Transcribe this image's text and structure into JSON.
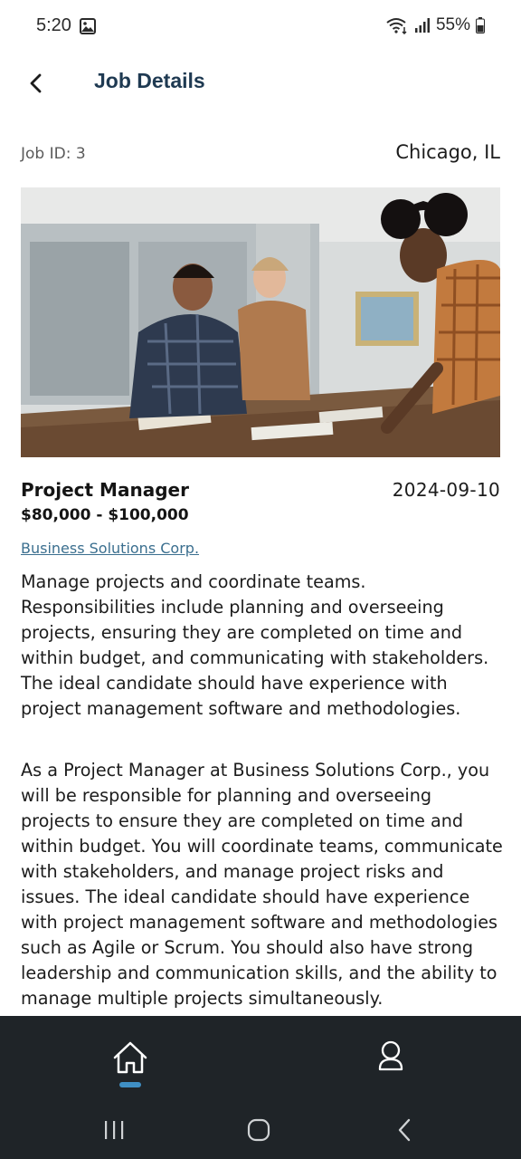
{
  "status_bar": {
    "time": "5:20",
    "battery": "55%",
    "icons": [
      "image-icon",
      "wifi-icon",
      "signal-icon",
      "battery-icon"
    ]
  },
  "header": {
    "title": "Job Details",
    "back_icon": "chevron-left-icon"
  },
  "job": {
    "id_label": "Job ID: 3",
    "location": "Chicago, IL",
    "title": "Project Manager",
    "date": "2024-09-10",
    "salary": "$80,000 - $100,000",
    "company": "Business Solutions Corp.",
    "summary": "Manage projects and coordinate teams. Responsibilities include planning and overseeing projects, ensuring they are completed on time and within budget, and communicating with stakeholders. The ideal candidate should have experience with project management software and methodologies.",
    "description": "As a Project Manager at Business Solutions Corp., you will be responsible for planning and overseeing projects to ensure they are completed on time and within budget. You will coordinate teams, communicate with stakeholders, and manage project risks and issues. The ideal candidate should have experience with project management software and methodologies such as Agile or Scrum. You should also have strong leadership and communication skills, and the ability to manage multiple projects simultaneously."
  },
  "bottom_nav": {
    "items": [
      {
        "icon": "home-icon",
        "active": true
      },
      {
        "icon": "profile-icon",
        "active": false
      }
    ],
    "accent": "#3f8fc4",
    "background": "#1f2428"
  },
  "colors": {
    "title": "#1f3a52",
    "link": "#3b6f8f"
  }
}
